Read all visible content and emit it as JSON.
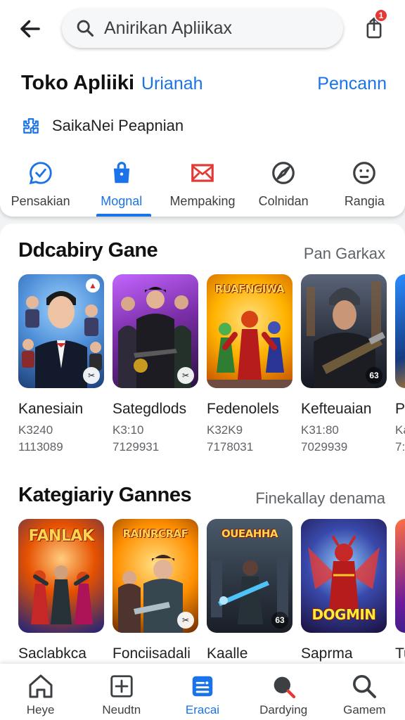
{
  "search": {
    "placeholder": "Anirikan Apliikax",
    "notification_count": "1"
  },
  "header": {
    "title": "Toko Apliiki",
    "subtitle": "Urianah",
    "right_link": "Pencann"
  },
  "promo": {
    "text": "SaikaNei Peapnian"
  },
  "tabs": [
    {
      "label": "Pensakian",
      "icon": "chat-bubble-icon"
    },
    {
      "label": "Mognal",
      "icon": "shopping-bag-icon"
    },
    {
      "label": "Mempaking",
      "icon": "mail-icon"
    },
    {
      "label": "Colnidan",
      "icon": "compass-icon"
    },
    {
      "label": "Rangia",
      "icon": "face-icon"
    }
  ],
  "active_tab": "Mognal",
  "section1": {
    "title": "Ddcabiry Gane",
    "link": "Pan Garkax",
    "cards": [
      {
        "name": "Kanesiain",
        "meta1": "K3240",
        "meta2": "1113089",
        "badge": "✂"
      },
      {
        "name": "Sategdlods",
        "meta1": "K3:10",
        "meta2": "7129931",
        "badge": "✂"
      },
      {
        "name": "Fedenolels",
        "meta1": "K32K9",
        "meta2": "7178031",
        "poster": "RUAFNGIWA",
        "badge": ""
      },
      {
        "name": "Keftеuaian",
        "meta1": "K31:80",
        "meta2": "7029939",
        "badge": "63"
      },
      {
        "name": "Pl",
        "meta1": "Ka",
        "meta2": "7:",
        "badge": ""
      }
    ]
  },
  "section2": {
    "title": "Kategiariy Gannes",
    "link": "Finekallay denama",
    "cards": [
      {
        "name": "Saclabkca",
        "poster": "FANLAK",
        "badge": ""
      },
      {
        "name": "Fonciisadali",
        "poster": "RAINRCRAF",
        "badge": "✂"
      },
      {
        "name": "Kaalle",
        "poster": "OUEAHHA",
        "badge": "63"
      },
      {
        "name": "Saprma",
        "poster": "DOGMIN",
        "badge": ""
      },
      {
        "name": "Tu",
        "poster": "",
        "badge": ""
      }
    ]
  },
  "bottom_nav": [
    {
      "label": "Heye",
      "icon": "home-icon"
    },
    {
      "label": "Neudtn",
      "icon": "add-box-icon"
    },
    {
      "label": "Eracai",
      "icon": "list-icon"
    },
    {
      "label": "Dardying",
      "icon": "record-icon"
    },
    {
      "label": "Gamem",
      "icon": "search-icon"
    }
  ],
  "active_nav": "Eracai",
  "colors": {
    "accent": "#1a73e8",
    "badge_red": "#e53935"
  }
}
